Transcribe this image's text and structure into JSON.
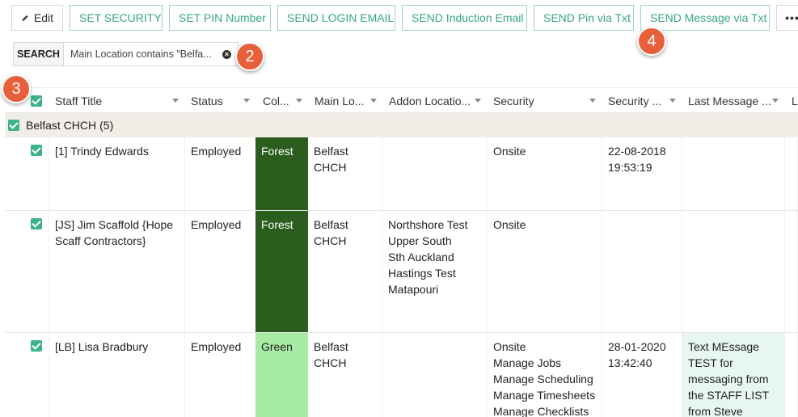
{
  "toolbar": {
    "buttons": [
      {
        "label": "Edit"
      },
      {
        "label": "SET SECURITY"
      },
      {
        "label": "SET PIN Number"
      },
      {
        "label": "SEND LOGIN EMAIL"
      },
      {
        "label": "SEND Induction Email"
      },
      {
        "label": "SEND Pin via Txt"
      },
      {
        "label": "SEND Message via Txt"
      }
    ],
    "more_label": "•••"
  },
  "search": {
    "label": "SEARCH",
    "chip": "Main Location contains \"Belfa...",
    "clear_symbol": "×"
  },
  "markers": {
    "m2": "2",
    "m3": "3",
    "m4": "4"
  },
  "columns": [
    {
      "label": "Staff Title"
    },
    {
      "label": "Status"
    },
    {
      "label": "Col..."
    },
    {
      "label": "Main Lo..."
    },
    {
      "label": "Addon Locatio..."
    },
    {
      "label": "Security"
    },
    {
      "label": "Security ..."
    },
    {
      "label": "Last Message ..."
    },
    {
      "label": "L"
    }
  ],
  "group": {
    "label": "Belfast CHCH",
    "count": "(5)"
  },
  "colors": {
    "accent": "#3db08d",
    "forest": "#2b5e1e",
    "green": "#a8eba4",
    "group_bg": "#f1ede7"
  },
  "rows": [
    {
      "title": [
        "[1] Trindy Edwards"
      ],
      "status": "Employed",
      "color": "Forest",
      "main_location": [
        "Belfast",
        "CHCH"
      ],
      "addon": [],
      "security": [
        "Onsite"
      ],
      "security_date": [
        "22-08-2018",
        "19:53:19"
      ],
      "last_message": []
    },
    {
      "title": [
        "[JS] Jim Scaffold {Hope",
        "Scaff Contractors}"
      ],
      "status": "Employed",
      "color": "Forest",
      "main_location": [
        "Belfast",
        "CHCH"
      ],
      "addon": [
        "Northshore Test",
        "Upper South",
        "Sth Auckland",
        "Hastings Test",
        "Matapouri"
      ],
      "security": [
        "Onsite"
      ],
      "security_date": [],
      "last_message": []
    },
    {
      "title": [
        "[LB] Lisa Bradbury"
      ],
      "status": "Employed",
      "color": "Green",
      "main_location": [
        "Belfast",
        "CHCH"
      ],
      "addon": [],
      "security": [
        "Onsite",
        "Manage Jobs",
        "Manage Scheduling",
        "Manage Timesheets",
        "Manage Checklists"
      ],
      "security_date": [
        "28-01-2020",
        "13:42:40"
      ],
      "last_message": [
        "Text MEssage",
        "TEST for",
        "messaging from",
        "the STAFF LIST",
        "from Steve"
      ]
    }
  ]
}
